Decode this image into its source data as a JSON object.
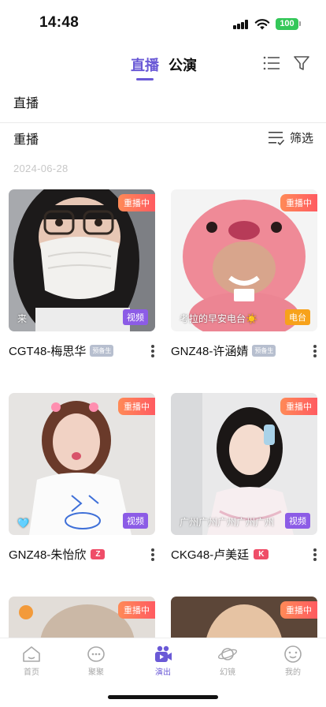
{
  "status_bar": {
    "time": "14:48",
    "battery": "100"
  },
  "header": {
    "tabs": [
      {
        "label": "直播",
        "active": true
      },
      {
        "label": "公演",
        "active": false
      }
    ]
  },
  "sections": {
    "live_label": "直播",
    "replay_label": "重播",
    "filter_label": "筛选"
  },
  "date": "2024-06-28",
  "cards": [
    {
      "name": "CGT48-梅思华",
      "member_tag": "预备生",
      "replay_badge": "重播中",
      "type_badge": "视频",
      "caption": "来"
    },
    {
      "name": "GNZ48-许涵婧",
      "member_tag": "预备生",
      "replay_badge": "重播中",
      "type_badge": "电台",
      "caption": "考拉的早安电台☀️"
    },
    {
      "name": "GNZ48-朱怡欣",
      "team_tag": "Z",
      "replay_badge": "重播中",
      "type_badge": "视频",
      "caption": "🩵"
    },
    {
      "name": "CKG48-卢美廷",
      "team_tag": "K",
      "replay_badge": "重播中",
      "type_badge": "视频",
      "caption": "广州广州广州广州广州"
    },
    {
      "replay_badge": "重播中"
    },
    {
      "replay_badge": "重播中"
    }
  ],
  "tabbar": [
    {
      "label": "首页",
      "icon": "home-icon"
    },
    {
      "label": "聚聚",
      "icon": "chat-icon"
    },
    {
      "label": "演出",
      "icon": "show-icon",
      "active": true
    },
    {
      "label": "幻镜",
      "icon": "planet-icon"
    },
    {
      "label": "我的",
      "icon": "face-icon"
    }
  ],
  "colors": {
    "accent": "#6a59d6",
    "replay_badge": "#ff6a5c",
    "video_badge": "#8c5ce6",
    "radio_badge": "#f7a21b",
    "team_tag": "#ef4d68"
  }
}
